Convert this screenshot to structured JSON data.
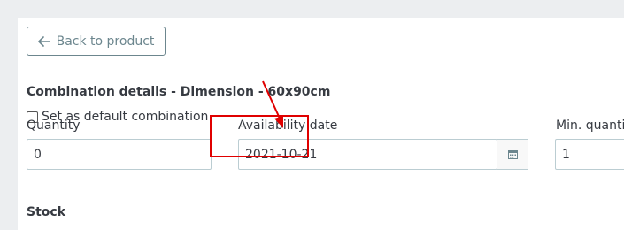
{
  "back_button": {
    "label": "Back to product"
  },
  "combination": {
    "title": "Combination details - Dimension - 60x90cm",
    "default_checkbox_label": "Set as default combination"
  },
  "fields": {
    "quantity": {
      "label": "Quantity",
      "value": "0"
    },
    "availability_date": {
      "label": "Availability date",
      "value": "2021-10-21"
    },
    "min_quantity": {
      "label": "Min. quantit",
      "value": "1"
    }
  },
  "stock": {
    "title": "Stock"
  },
  "colors": {
    "annotation": "#e00000",
    "accent": "#6c868e"
  },
  "icons": {
    "back": "arrow-left-icon",
    "calendar": "calendar-icon"
  }
}
